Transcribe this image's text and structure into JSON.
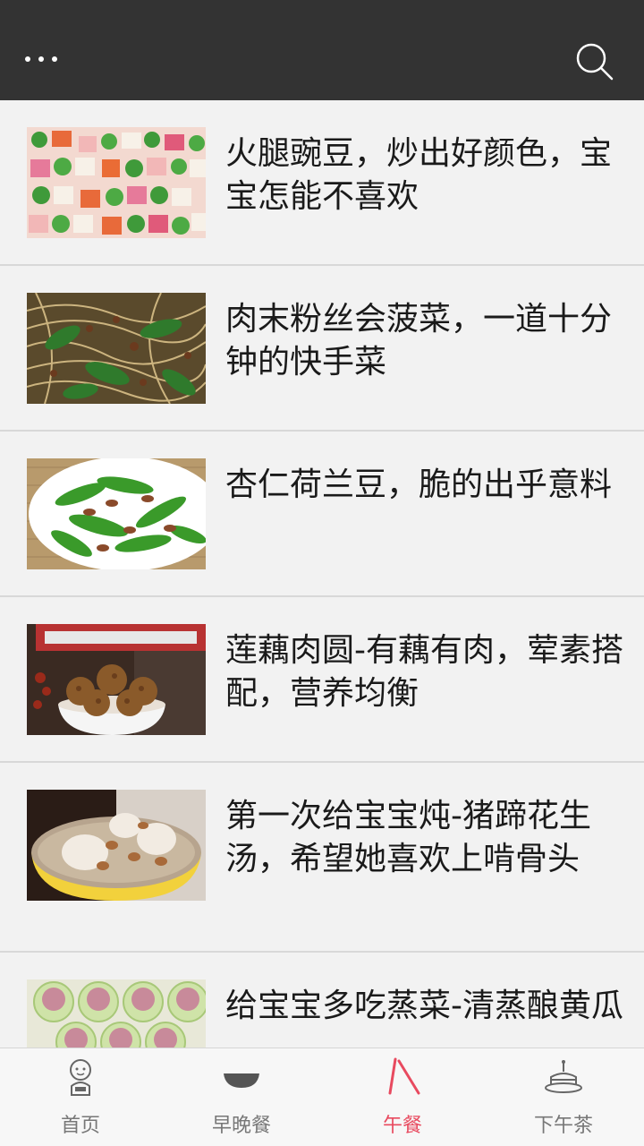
{
  "header": {
    "menu_icon": "more-dots-icon",
    "search_icon": "search-icon"
  },
  "articles": [
    {
      "title": "火腿豌豆，炒出好颜色，宝宝怎能不喜欢",
      "image": "ham-peas-dish"
    },
    {
      "title": "肉末粉丝会菠菜，一道十分钟的快手菜",
      "image": "pork-vermicelli-spinach-dish"
    },
    {
      "title": "杏仁荷兰豆，脆的出乎意料",
      "image": "almond-snow-peas-dish"
    },
    {
      "title": "莲藕肉圆-有藕有肉，荤素搭配，营养均衡",
      "image": "lotus-meatballs-dish"
    },
    {
      "title": "第一次给宝宝炖-猪蹄花生汤，希望她喜欢上啃骨头",
      "image": "pork-trotter-peanut-soup"
    },
    {
      "title": "给宝宝多吃蒸菜-清蒸酿黄瓜",
      "image": "steamed-stuffed-cucumber"
    }
  ],
  "tabs": [
    {
      "label": "首页",
      "icon": "baby-icon"
    },
    {
      "label": "早晚餐",
      "icon": "bowl-icon"
    },
    {
      "label": "午餐",
      "icon": "chopsticks-icon",
      "active": true
    },
    {
      "label": "下午茶",
      "icon": "cake-icon"
    }
  ],
  "colors": {
    "header_bg": "#333333",
    "active_tab": "#e84a5f",
    "inactive_tab": "#777777",
    "list_bg": "#f2f2f2"
  }
}
